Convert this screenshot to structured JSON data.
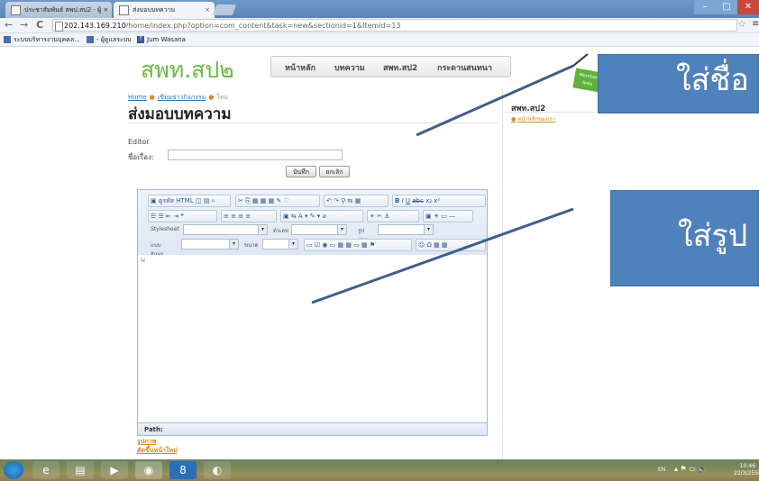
{
  "browser": {
    "tabs": [
      {
        "label": "ประชาสัมพันธ์ สพป.สป2 - ผู้ ×"
      },
      {
        "label": "ส่งมอบบทความ"
      }
    ],
    "tab_close": "×",
    "url_host": "202.143.169.210",
    "url_path": "/home/index.php?option=com_content&task=new&sectionid=1&Itemid=13",
    "nav": {
      "back": "←",
      "forward": "→",
      "reload": "C"
    },
    "star": "☆",
    "menu": "≡",
    "window": {
      "min": "–",
      "max": "□",
      "close": "✕"
    },
    "bookmarks": [
      {
        "label": "ระบบบริหารงานบุคคล..."
      },
      {
        "label": "- ผู้ดูแลระบบ"
      },
      {
        "label": "Jum Wasana"
      }
    ]
  },
  "site": {
    "logo": "สพท.สป๒",
    "menu": [
      "หน้าหลัก",
      "บทความ",
      "สพท.สป2",
      "กระดานสนทนา"
    ],
    "badge": "Member Area"
  },
  "content": {
    "breadcrumb": {
      "home": "Home",
      "section": "เขียนข่าวกิจกรรม",
      "current": "ใหม่"
    },
    "title": "ส่งมอบบทความ",
    "editor_label": "Editor",
    "subject_label": "ชื่อเรื่อง:",
    "subject_value": "",
    "save_button": "บันทึก",
    "cancel_button": "ยกเลิก",
    "toolbar": {
      "source_html": "ดูรหัส HTML",
      "stylesheet": "Stylesheet",
      "heading": "ตัวเลข",
      "format": "รูปแบบ",
      "font_family": "แบบอักษร",
      "size": "ขนาด",
      "bold": "B",
      "italic": "I",
      "underline": "U",
      "strike": "abc"
    },
    "path_label": "Path:",
    "image_link": "รูปภาพ",
    "pagebreak_link": "ตัดขึ้นหน้าใหม่"
  },
  "sidebar": {
    "title": "สพท.สป2",
    "link": "หน้าหลักของเรา"
  },
  "annotations": {
    "callout_name": "ใส่ชื่อ",
    "callout_image": "ใส่รูป",
    "color": "#4f81bd"
  },
  "taskbar": {
    "lang": "EN",
    "time": "10:46",
    "date": "22/3/2556"
  }
}
